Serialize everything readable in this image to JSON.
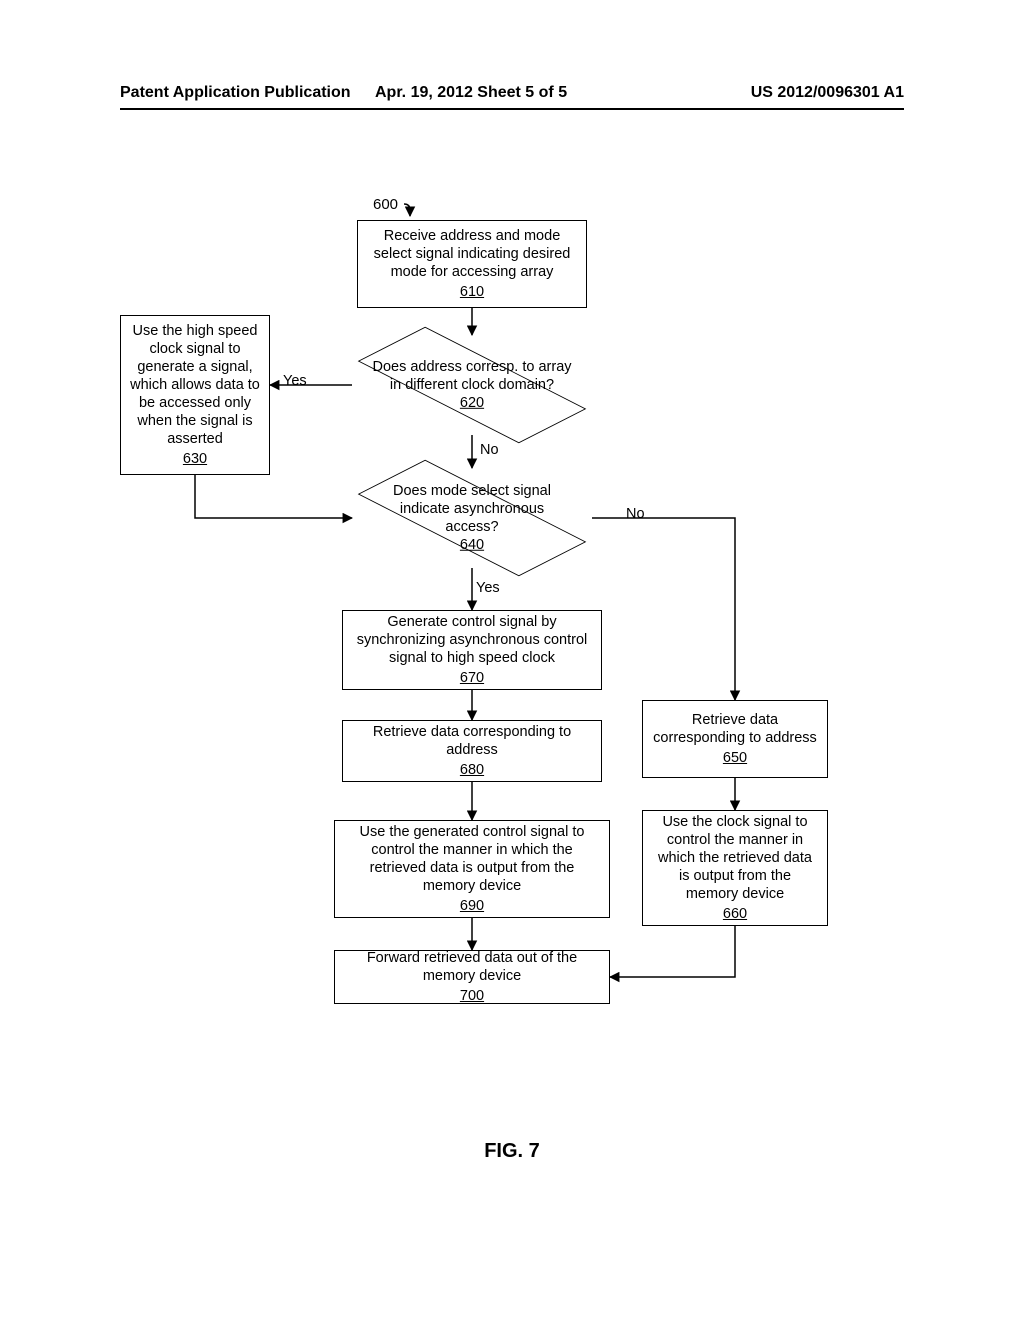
{
  "header": {
    "left": "Patent Application Publication",
    "mid": "Apr. 19, 2012  Sheet 5 of 5",
    "right": "US 2012/0096301 A1"
  },
  "flowchart_label": "600",
  "nodes": {
    "n610": {
      "text": "Receive address and mode select signal indicating desired mode for accessing array",
      "ref": "610"
    },
    "n620": {
      "text": "Does address corresp. to array in different clock domain?",
      "ref": "620"
    },
    "n630": {
      "text": "Use the high speed clock signal to generate a signal, which allows data to be accessed only when the signal is asserted",
      "ref": "630"
    },
    "n640": {
      "text": "Does mode select signal indicate asynchronous access?",
      "ref": "640"
    },
    "n650": {
      "text": "Retrieve data corresponding to address",
      "ref": "650"
    },
    "n660": {
      "text": "Use the clock signal to control the manner in which the retrieved data is output from the memory device",
      "ref": "660"
    },
    "n670": {
      "text": "Generate control signal by synchronizing asynchronous control signal to high speed clock",
      "ref": "670"
    },
    "n680": {
      "text": "Retrieve data corresponding to address",
      "ref": "680"
    },
    "n690": {
      "text": "Use the generated control signal to control the manner in which the retrieved data is output from the memory device",
      "ref": "690"
    },
    "n700": {
      "text": "Forward retrieved data out of the memory device",
      "ref": "700"
    }
  },
  "edge_labels": {
    "yes620": "Yes",
    "no620": "No",
    "yes640": "Yes",
    "no640": "No"
  },
  "figure_caption": "FIG. 7",
  "chart_data": {
    "type": "flowchart",
    "title": "FIG. 7",
    "label": "600",
    "nodes": [
      {
        "id": "610",
        "shape": "process",
        "text": "Receive address and mode select signal indicating desired mode for accessing array"
      },
      {
        "id": "620",
        "shape": "decision",
        "text": "Does address corresp. to array in different clock domain?"
      },
      {
        "id": "630",
        "shape": "process",
        "text": "Use the high speed clock signal to generate a signal, which allows data to be accessed only when the signal is asserted"
      },
      {
        "id": "640",
        "shape": "decision",
        "text": "Does mode select signal indicate asynchronous access?"
      },
      {
        "id": "650",
        "shape": "process",
        "text": "Retrieve data corresponding to address"
      },
      {
        "id": "660",
        "shape": "process",
        "text": "Use the clock signal to control the manner in which the retrieved data is output from the memory device"
      },
      {
        "id": "670",
        "shape": "process",
        "text": "Generate control signal by synchronizing asynchronous control signal to high speed clock"
      },
      {
        "id": "680",
        "shape": "process",
        "text": "Retrieve data corresponding to address"
      },
      {
        "id": "690",
        "shape": "process",
        "text": "Use the generated control signal to control the manner in which the retrieved data is output from the memory device"
      },
      {
        "id": "700",
        "shape": "process",
        "text": "Forward retrieved data out of the memory device"
      }
    ],
    "edges": [
      {
        "from": "start",
        "to": "610"
      },
      {
        "from": "610",
        "to": "620"
      },
      {
        "from": "620",
        "to": "630",
        "label": "Yes"
      },
      {
        "from": "620",
        "to": "640",
        "label": "No"
      },
      {
        "from": "630",
        "to": "640"
      },
      {
        "from": "640",
        "to": "670",
        "label": "Yes"
      },
      {
        "from": "640",
        "to": "650",
        "label": "No"
      },
      {
        "from": "650",
        "to": "660"
      },
      {
        "from": "660",
        "to": "700"
      },
      {
        "from": "670",
        "to": "680"
      },
      {
        "from": "680",
        "to": "690"
      },
      {
        "from": "690",
        "to": "700"
      }
    ]
  }
}
